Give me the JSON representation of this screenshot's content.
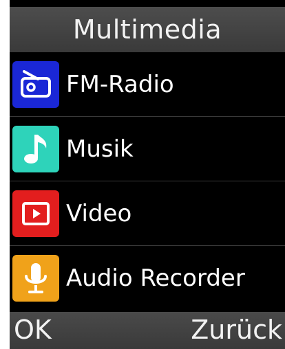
{
  "header": {
    "title": "Multimedia"
  },
  "menu": {
    "items": [
      {
        "label": "FM-Radio",
        "icon": "radio-icon",
        "icon_color": "#1a27d6"
      },
      {
        "label": "Musik",
        "icon": "music-note-icon",
        "icon_color": "#2ed3ba"
      },
      {
        "label": "Video",
        "icon": "video-play-icon",
        "icon_color": "#e31e1e"
      },
      {
        "label": "Audio Recorder",
        "icon": "microphone-icon",
        "icon_color": "#f0a21a"
      }
    ]
  },
  "softkeys": {
    "left": "OK",
    "right": "Zurück"
  },
  "colors": {
    "background": "#000000",
    "bar": "#404040",
    "text": "#ffffff"
  }
}
